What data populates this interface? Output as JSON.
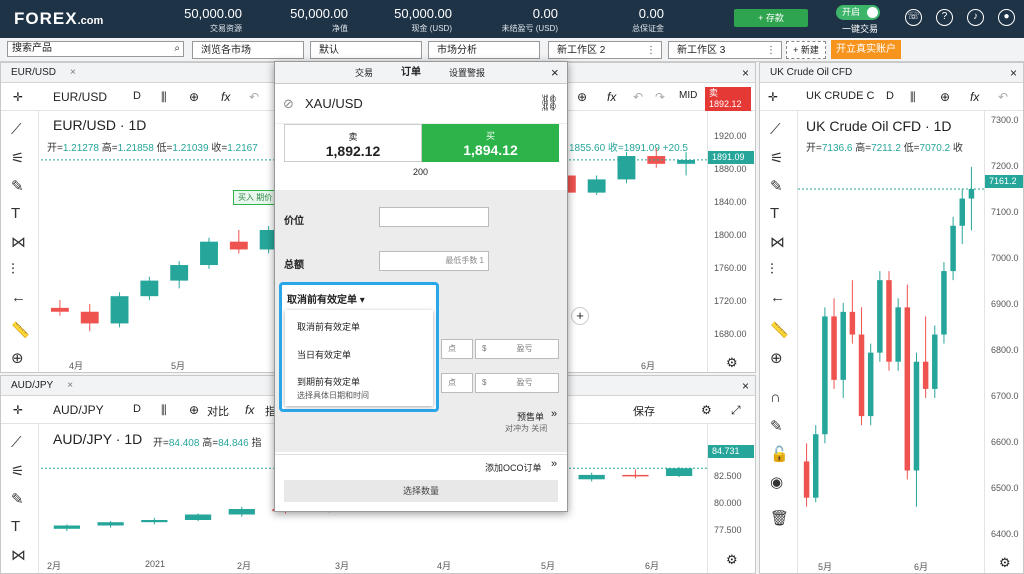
{
  "brand": {
    "logo_main": "FOREX",
    "logo_suffix": ".com"
  },
  "account": {
    "stats": [
      {
        "value": "50,000.00",
        "label": "交易资源"
      },
      {
        "value": "50,000.00",
        "label": "净值"
      },
      {
        "value": "50,000.00",
        "label": "现金 (USD)"
      },
      {
        "value": "0.00",
        "label": "未结盈亏 (USD)"
      },
      {
        "value": "0.00",
        "label": "总保证金"
      }
    ],
    "deposit_label": "+ 存款",
    "one_click_state": "开启",
    "one_click_label": "一键交易"
  },
  "workspace": {
    "search_placeholder": "搜索产品",
    "tabs": [
      "浏览各市场",
      "默认",
      "市场分析",
      "新工作区 2",
      "新工作区 3"
    ],
    "new_label": "+ 新建",
    "real_account_label": "开立真实账户"
  },
  "panels": {
    "eurusd": {
      "tab": "EUR/USD",
      "symbol": "EUR/USD",
      "interval": "D",
      "title": "EUR/USD · 1D",
      "ohlc": {
        "o_lbl": "开=",
        "o": "1.21278",
        "h_lbl": "高=",
        "h": "1.21858",
        "l_lbl": "低=",
        "l": "1.21039",
        "c_lbl": "收=",
        "c": "1.2167"
      },
      "badge": "买入 期价",
      "right_partial": "1855.60  收=1891.09  +20.5",
      "mid": "MID",
      "sell_tag": "卖",
      "sell_price": "1892.12",
      "yticks": [
        "1920.00",
        "1880.00",
        "1840.00",
        "1800.00",
        "1760.00",
        "1720.00",
        "1680.00"
      ],
      "price": "1891.09",
      "xticks": [
        "4月",
        "5月",
        "6月"
      ]
    },
    "audjpy": {
      "tab": "AUD/JPY",
      "symbol": "AUD/JPY",
      "interval": "D",
      "compare": "对比",
      "indicator": "指",
      "title": "AUD/JPY · 1D",
      "ohlc": {
        "o_lbl": "开=",
        "o": "84.408",
        "h_lbl": "高=",
        "h": "84.846",
        "ind_lbl": "指"
      },
      "save": "保存",
      "yticks": [
        "82.500",
        "80.000",
        "77.500"
      ],
      "price": "84.731",
      "xticks": [
        "2月",
        "2021",
        "2月",
        "3月",
        "4月",
        "5月",
        "6月"
      ]
    },
    "ukoil": {
      "tab": "UK Crude Oil CFD",
      "symbol": "UK CRUDE C",
      "interval": "D",
      "title": "UK Crude Oil CFD · 1D",
      "ohlc": {
        "o_lbl": "开=",
        "o": "7136.6",
        "h_lbl": "高=",
        "h": "7211.2",
        "l_lbl": "低=",
        "l": "7070.2",
        "c_lbl": "收"
      },
      "yticks": [
        "7300.0",
        "7200.0",
        "7100.0",
        "7000.0",
        "6900.0",
        "6800.0",
        "6700.0",
        "6600.0",
        "6500.0",
        "6400.0"
      ],
      "price": "7161.2",
      "xticks": [
        "5月",
        "6月"
      ]
    }
  },
  "order": {
    "tabs": [
      "交易",
      "订单",
      "设置警报"
    ],
    "symbol": "XAU/USD",
    "sell_label": "卖",
    "sell_price": "1,892.12",
    "buy_label": "买",
    "buy_price": "1,894.12",
    "spread": "200",
    "price_label": "价位",
    "amount_label": "总额",
    "min_lot": "最低手数 1",
    "tif_selected": "取消前有效定单",
    "tif_options": [
      "取消前有效定单",
      "当日有效定单",
      "到期前有效定单"
    ],
    "tif_option3_sub": "选择具体日期和时间",
    "pts": "点",
    "dollar": "$",
    "pnl": "盈亏",
    "pending_label": "预售单",
    "hedge": "对冲为 关闭",
    "oco_label": "添加OCO订单",
    "select_qty": "选择数量"
  },
  "colors": {
    "up": "#26a69a",
    "down": "#ef5350",
    "buy": "#2cb34a",
    "sell_tag": "#e53935",
    "accent": "#2aa7e8",
    "header": "#1f3347",
    "orange": "#f7941d"
  },
  "chart_data": [
    {
      "type": "candlestick",
      "title": "EUR/USD · 1D",
      "ylim": [
        1660,
        1940
      ],
      "xticks": [
        "4月",
        "5月",
        "6月"
      ],
      "ohlc": [
        [
          1700,
          1710,
          1690,
          1695
        ],
        [
          1695,
          1705,
          1670,
          1680
        ],
        [
          1680,
          1720,
          1675,
          1715
        ],
        [
          1715,
          1740,
          1710,
          1735
        ],
        [
          1735,
          1760,
          1725,
          1755
        ],
        [
          1755,
          1790,
          1750,
          1785
        ],
        [
          1785,
          1800,
          1770,
          1775
        ],
        [
          1775,
          1805,
          1770,
          1800
        ],
        [
          1800,
          1830,
          1795,
          1825
        ],
        [
          1825,
          1840,
          1810,
          1815
        ],
        [
          1815,
          1850,
          1810,
          1845
        ],
        [
          1845,
          1870,
          1835,
          1860
        ],
        [
          1860,
          1880,
          1845,
          1850
        ],
        [
          1850,
          1865,
          1830,
          1840
        ],
        [
          1840,
          1870,
          1835,
          1865
        ],
        [
          1865,
          1885,
          1855,
          1880
        ],
        [
          1880,
          1890,
          1860,
          1870
        ],
        [
          1870,
          1880,
          1840,
          1848
        ],
        [
          1848,
          1870,
          1845,
          1865
        ],
        [
          1865,
          1900,
          1860,
          1895
        ],
        [
          1895,
          1905,
          1880,
          1885
        ],
        [
          1885,
          1900,
          1870,
          1890
        ]
      ]
    },
    {
      "type": "candlestick",
      "title": "AUD/JPY · 1D",
      "ylim": [
        76,
        86
      ],
      "xticks": [
        "2月",
        "2021",
        "2月",
        "3月",
        "4月",
        "5月",
        "6月"
      ],
      "ohlc": [
        [
          77.2,
          77.6,
          77.0,
          77.5
        ],
        [
          77.5,
          77.9,
          77.3,
          77.8
        ],
        [
          77.8,
          78.2,
          77.6,
          78.0
        ],
        [
          78.0,
          78.6,
          77.9,
          78.5
        ],
        [
          78.5,
          79.2,
          78.3,
          79.0
        ],
        [
          79.0,
          79.4,
          78.6,
          78.8
        ],
        [
          78.8,
          79.8,
          78.7,
          79.6
        ],
        [
          79.6,
          80.4,
          79.4,
          80.2
        ],
        [
          80.2,
          80.6,
          79.9,
          80.1
        ],
        [
          80.1,
          80.9,
          80.0,
          80.8
        ],
        [
          80.8,
          81.4,
          80.6,
          81.2
        ],
        [
          81.2,
          81.9,
          81.0,
          81.7
        ],
        [
          81.7,
          82.3,
          81.5,
          82.1
        ],
        [
          82.1,
          82.6,
          81.8,
          82.0
        ],
        [
          82.0,
          82.8,
          81.9,
          82.7
        ]
      ]
    },
    {
      "type": "candlestick",
      "title": "UK Crude Oil CFD · 1D",
      "ylim": [
        6380,
        7320
      ],
      "xticks": [
        "5月",
        "6月"
      ],
      "ohlc": [
        [
          6560,
          6600,
          6460,
          6480
        ],
        [
          6480,
          6640,
          6470,
          6620
        ],
        [
          6620,
          6900,
          6600,
          6880
        ],
        [
          6880,
          6920,
          6720,
          6740
        ],
        [
          6740,
          6910,
          6700,
          6890
        ],
        [
          6890,
          6960,
          6820,
          6840
        ],
        [
          6840,
          6900,
          6640,
          6660
        ],
        [
          6660,
          6820,
          6640,
          6800
        ],
        [
          6800,
          6980,
          6780,
          6960
        ],
        [
          6960,
          6980,
          6760,
          6780
        ],
        [
          6780,
          6920,
          6760,
          6900
        ],
        [
          6900,
          6950,
          6520,
          6540
        ],
        [
          6540,
          6800,
          6460,
          6780
        ],
        [
          6780,
          6880,
          6700,
          6720
        ],
        [
          6720,
          6860,
          6700,
          6840
        ],
        [
          6840,
          7000,
          6820,
          6980
        ],
        [
          6980,
          7100,
          6960,
          7080
        ],
        [
          7080,
          7160,
          7040,
          7140
        ],
        [
          7140,
          7210,
          7070,
          7161
        ]
      ]
    }
  ]
}
